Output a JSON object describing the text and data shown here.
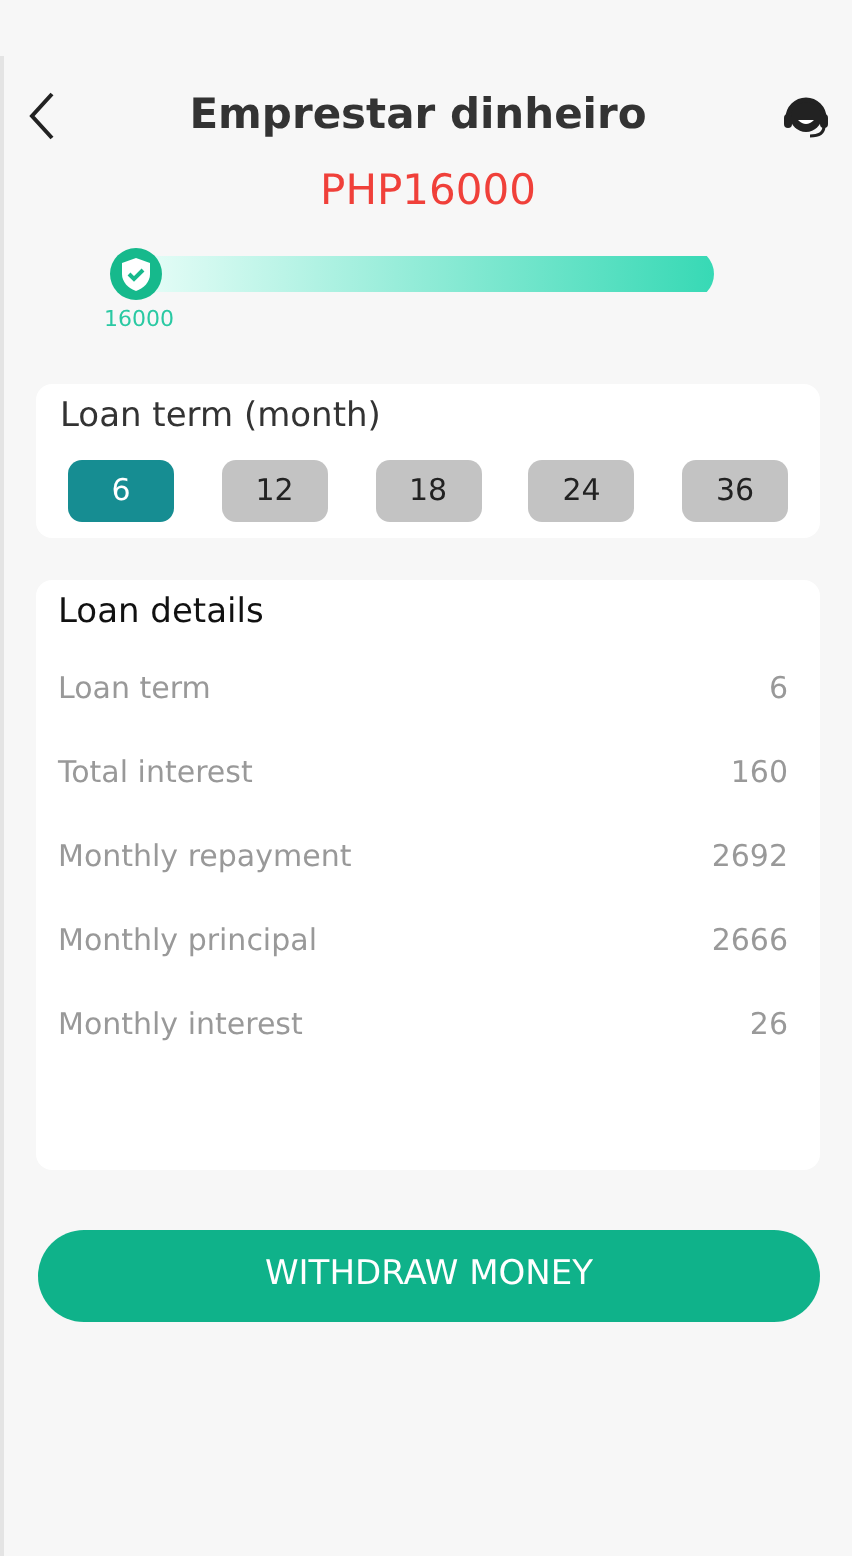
{
  "header": {
    "title": "Emprestar dinheiro"
  },
  "amount": "PHP16000",
  "slider": {
    "level": 0,
    "reading": "16000"
  },
  "term": {
    "title": "Loan term (month)",
    "options": [
      {
        "label": "6",
        "selected": true
      },
      {
        "label": "12",
        "selected": false
      },
      {
        "label": "18",
        "selected": false
      },
      {
        "label": "24",
        "selected": false
      },
      {
        "label": "36",
        "selected": false
      }
    ]
  },
  "details": {
    "title": "Loan details",
    "rows": [
      {
        "label": "Loan term",
        "value": "6"
      },
      {
        "label": "Total interest",
        "value": "160"
      },
      {
        "label": "Monthly repayment",
        "value": "2692"
      },
      {
        "label": "Monthly principal",
        "value": "2666"
      },
      {
        "label": "Monthly interest",
        "value": "26"
      }
    ]
  },
  "button": "WITHDRAW MONEY"
}
